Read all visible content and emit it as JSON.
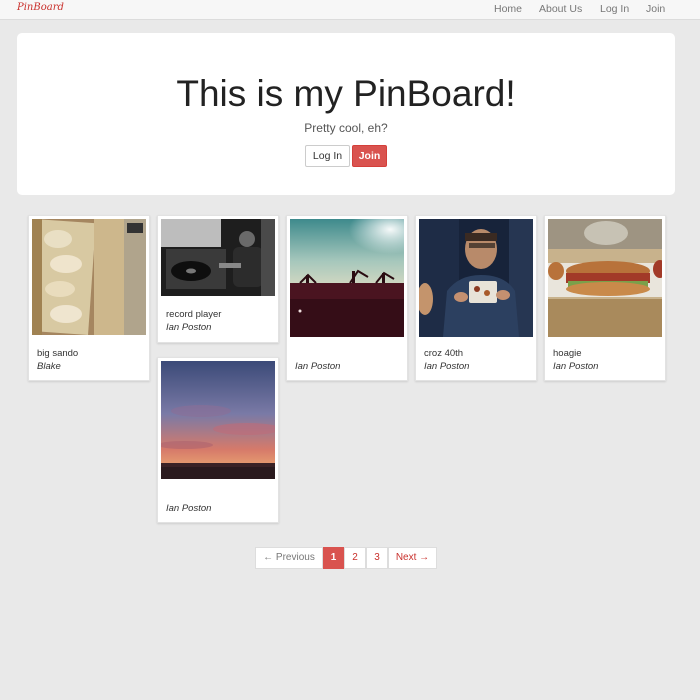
{
  "nav": {
    "brand": "PinBoard",
    "links": [
      "Home",
      "About Us",
      "Log In",
      "Join"
    ]
  },
  "hero": {
    "title": "This is my PinBoard!",
    "subtitle": "Pretty cool, eh?",
    "login_label": "Log In",
    "join_label": "Join"
  },
  "pins": [
    {
      "title": "big sando",
      "author": "Blake"
    },
    {
      "title": "record player",
      "author": "Ian Poston"
    },
    {
      "title": "",
      "author": "Ian Poston"
    },
    {
      "title": "croz 40th",
      "author": "Ian Poston"
    },
    {
      "title": "hoagie",
      "author": "Ian Poston"
    },
    {
      "title": "",
      "author": "Ian Poston"
    }
  ],
  "pagination": {
    "prev": "← Previous",
    "pages": [
      "1",
      "2",
      "3"
    ],
    "current": "1",
    "next": "Next →"
  },
  "colors": {
    "accent": "#d9534f",
    "background": "#e9e9e9"
  }
}
